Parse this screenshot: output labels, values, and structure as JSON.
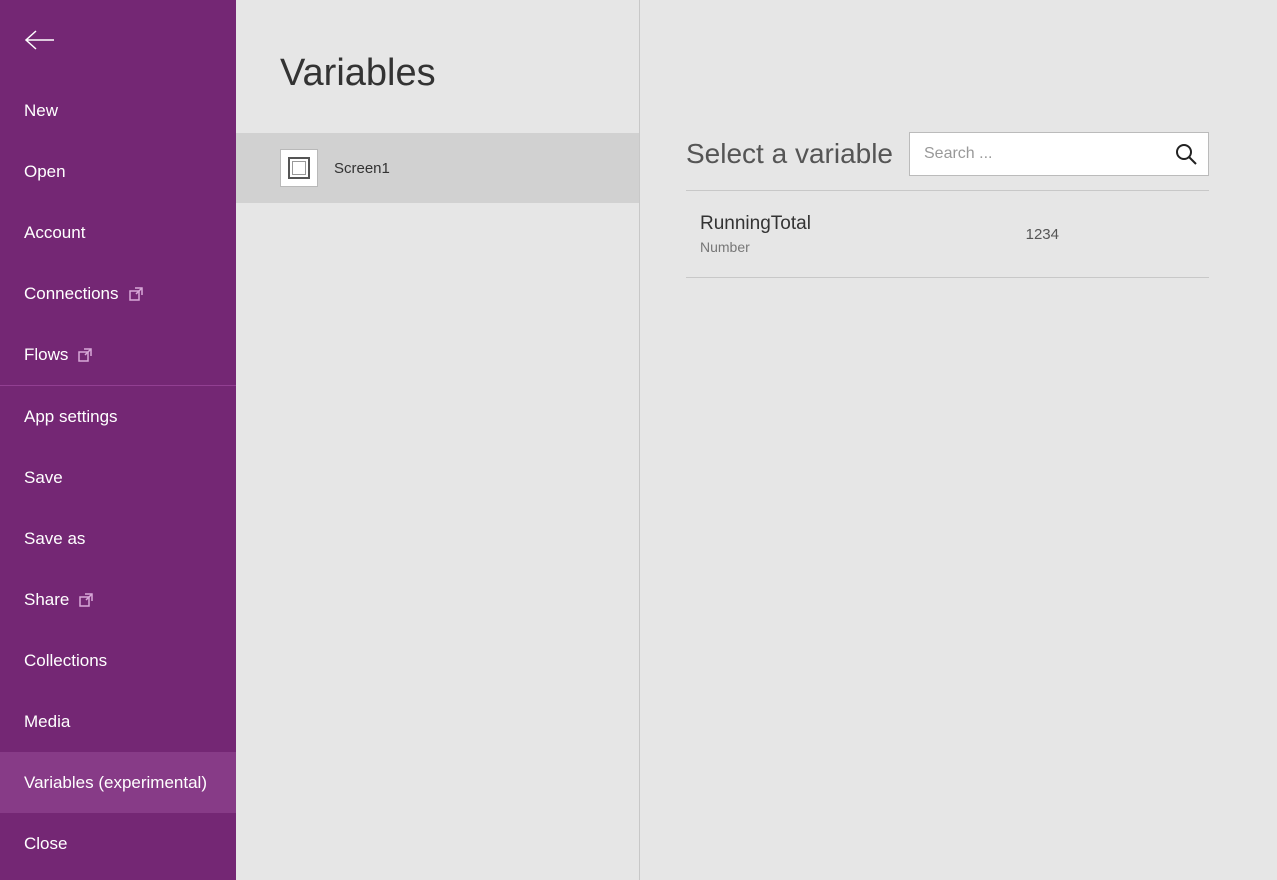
{
  "sidebar": {
    "items": [
      {
        "label": "New"
      },
      {
        "label": "Open"
      },
      {
        "label": "Account"
      },
      {
        "label": "Connections",
        "external": true
      },
      {
        "label": "Flows",
        "external": true
      },
      {
        "label": "App settings"
      },
      {
        "label": "Save"
      },
      {
        "label": "Save as"
      },
      {
        "label": "Share",
        "external": true
      },
      {
        "label": "Collections"
      },
      {
        "label": "Media"
      },
      {
        "label": "Variables (experimental)",
        "selected": true
      },
      {
        "label": "Close"
      }
    ]
  },
  "middle": {
    "title": "Variables",
    "screen_label": "Screen1"
  },
  "right": {
    "header": "Select a variable",
    "search_placeholder": "Search ...",
    "variables": [
      {
        "name": "RunningTotal",
        "type": "Number",
        "value": "1234"
      }
    ]
  }
}
